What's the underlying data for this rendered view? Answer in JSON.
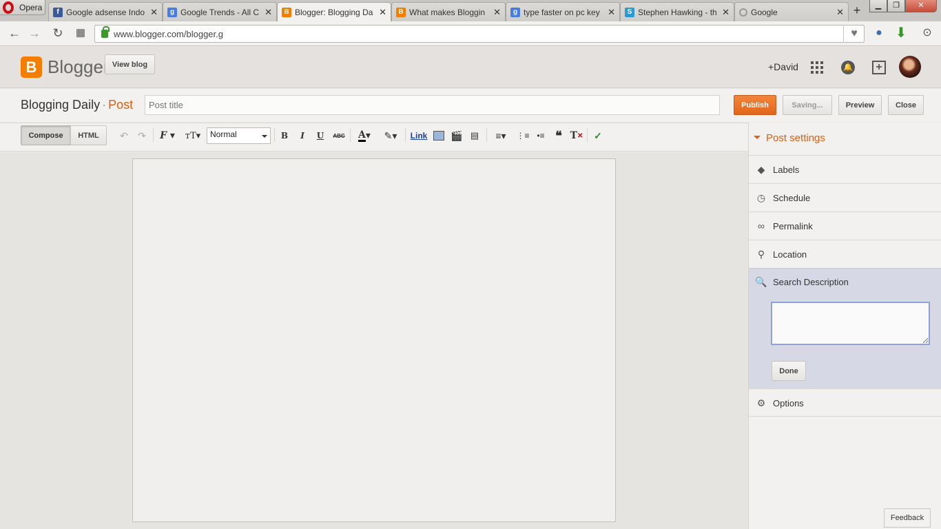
{
  "browser": {
    "opera_label": "Opera",
    "tabs": [
      {
        "title": "Google adsense Indo",
        "icon": "facebook-icon",
        "fav": "f"
      },
      {
        "title": "Google Trends - All C",
        "icon": "google-icon",
        "fav": "g"
      },
      {
        "title": "Blogger: Blogging Da",
        "icon": "blogger-icon",
        "fav": "B"
      },
      {
        "title": "What makes Bloggin",
        "icon": "blogger-icon",
        "fav": "B"
      },
      {
        "title": "type faster on pc key",
        "icon": "google-icon",
        "fav": "g"
      },
      {
        "title": "Stephen Hawking - th",
        "icon": "site-icon",
        "fav": "S"
      },
      {
        "title": "Google",
        "icon": "loading-icon",
        "fav": ""
      }
    ],
    "active_tab": 2,
    "url": "www.blogger.com/blogger.g"
  },
  "header": {
    "logo_letter": "B",
    "brand": "Blogger",
    "view_blog_label": "View blog",
    "user_label": "+David"
  },
  "post": {
    "blog_name": "Blogging Daily",
    "separator": "·",
    "section": "Post",
    "title_placeholder": "Post title",
    "title_value": "",
    "publish_label": "Publish",
    "saving_label": "Saving...",
    "preview_label": "Preview",
    "close_label": "Close"
  },
  "toolbar": {
    "compose_label": "Compose",
    "html_label": "HTML",
    "format_value": "Normal",
    "bold": "B",
    "italic": "I",
    "underline": "U",
    "strike": "ABC",
    "link_label": "Link"
  },
  "sidebar": {
    "title": "Post settings",
    "items": [
      {
        "label": "Labels",
        "icon": "tag-icon"
      },
      {
        "label": "Schedule",
        "icon": "clock-icon"
      },
      {
        "label": "Permalink",
        "icon": "link-icon"
      },
      {
        "label": "Location",
        "icon": "pin-icon"
      },
      {
        "label": "Search Description",
        "icon": "search-icon"
      },
      {
        "label": "Options",
        "icon": "gear-icon"
      }
    ],
    "search_description_value": "",
    "done_label": "Done"
  },
  "feedback_label": "Feedback",
  "colors": {
    "accent": "#dd5f10",
    "publish": "#e8711f",
    "panel_highlight": "#d6d8e6"
  }
}
